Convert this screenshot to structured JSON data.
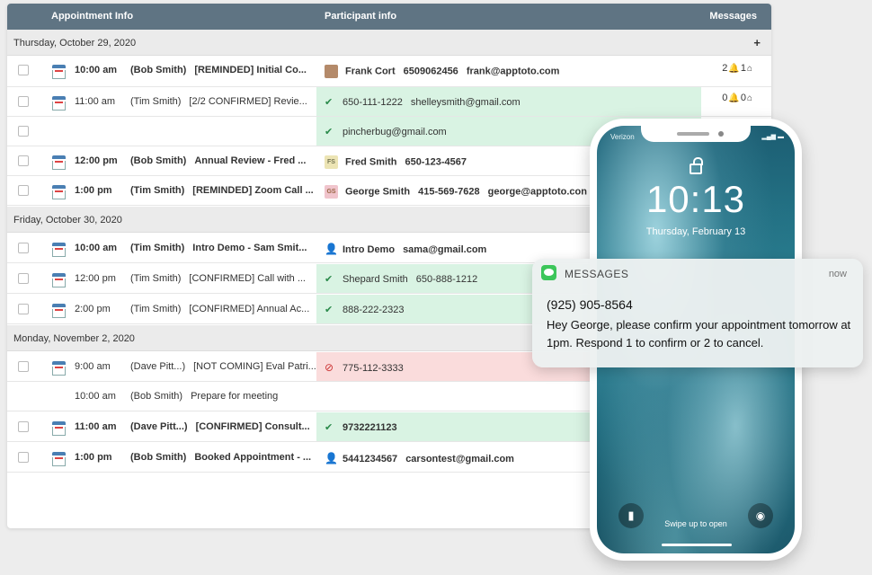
{
  "header": {
    "appointment": "Appointment Info",
    "participant": "Participant info",
    "messages": "Messages"
  },
  "dates": {
    "d1": "Thursday, October 29, 2020",
    "d2": "Friday, October 30, 2020",
    "d3": "Monday, November 2, 2020",
    "plus": "+"
  },
  "rows": [
    {
      "time": "10:00 am",
      "who": "(Bob Smith)",
      "desc": "[REMINDED] Initial Co...",
      "pname": "Frank Cort",
      "phone": "6509062456",
      "email": "frank@apptoto.com",
      "msg_count": "2",
      "msg_read": "1"
    },
    {
      "time": "11:00 am",
      "who": "(Tim Smith)",
      "desc": "[2/2 CONFIRMED] Revie...",
      "phone": "650-111-1222",
      "email": "shelleysmith@gmail.com",
      "msg_count": "0",
      "msg_read": "0"
    },
    {
      "email": "pincherbug@gmail.com"
    },
    {
      "time": "12:00 pm",
      "who": "(Bob Smith)",
      "desc": "Annual Review - Fred ...",
      "initials": "FS",
      "pname": "Fred Smith",
      "phone": "650-123-4567"
    },
    {
      "time": "1:00 pm",
      "who": "(Tim Smith)",
      "desc": "[REMINDED] Zoom Call ...",
      "initials": "GS",
      "pname": "George Smith",
      "phone": "415-569-7628",
      "email": "george@apptoto.con"
    },
    {
      "time": "10:00 am",
      "who": "(Tim Smith)",
      "desc": "Intro Demo - Sam Smit...",
      "pname": "Intro Demo",
      "email": "sama@gmail.com"
    },
    {
      "time": "12:00 pm",
      "who": "(Tim Smith)",
      "desc": "[CONFIRMED] Call with ...",
      "pname": "Shepard Smith",
      "phone": "650-888-1212"
    },
    {
      "time": "2:00 pm",
      "who": "(Tim Smith)",
      "desc": "[CONFIRMED] Annual Ac...",
      "phone": "888-222-2323"
    },
    {
      "time": "9:00 am",
      "who": "(Dave Pitt...)",
      "desc": "[NOT COMING] Eval Patri...",
      "phone": "775-112-3333"
    },
    {
      "time": "10:00 am",
      "who": "(Bob Smith)",
      "desc": "Prepare for meeting"
    },
    {
      "time": "11:00 am",
      "who": "(Dave Pitt...)",
      "desc": "[CONFIRMED] Consult...",
      "phone": "9732221123"
    },
    {
      "time": "1:00 pm",
      "who": "(Bob Smith)",
      "desc": "Booked Appointment - ...",
      "phone": "5441234567",
      "email": "carsontest@gmail.com"
    }
  ],
  "phone": {
    "carrier": "Verizon",
    "time": "10:13",
    "date": "Thursday, February 13",
    "swipe": "Swipe up to open"
  },
  "notification": {
    "app": "MESSAGES",
    "when": "now",
    "sender": "(925) 905-8564",
    "body": "Hey George, please confirm your appointment tomorrow at 1pm. Respond 1 to confirm or 2 to cancel."
  },
  "colors": {
    "header": "#5f7483",
    "confirmed": "#d9f3e3",
    "not_coming": "#fadcdc",
    "messages_app": "#3cc65a"
  }
}
